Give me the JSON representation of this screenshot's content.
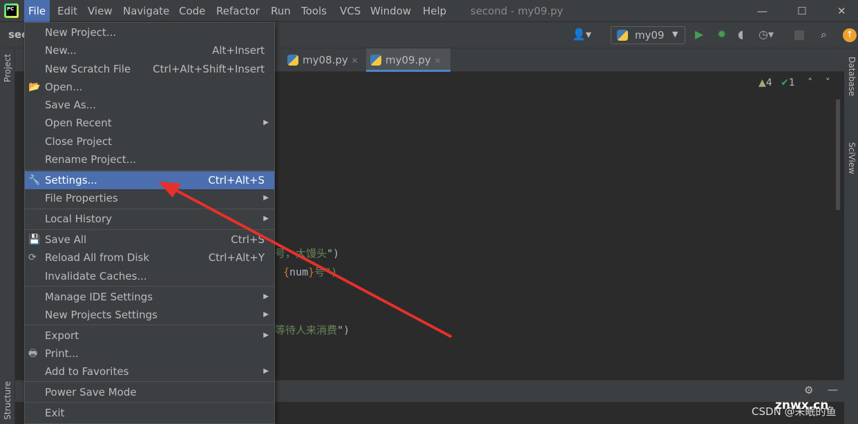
{
  "menubar": {
    "items": [
      "File",
      "Edit",
      "View",
      "Navigate",
      "Code",
      "Refactor",
      "Run",
      "Tools",
      "VCS",
      "Window",
      "Help"
    ],
    "window_title": "second - my09.py"
  },
  "toolbar": {
    "project_crumb": "sec",
    "run_config": "my09"
  },
  "tabs": [
    {
      "label": "my08.py"
    },
    {
      "label": "my09.py",
      "selected": true
    }
  ],
  "inspections": {
    "warnings": "4",
    "ok": "1"
  },
  "side": {
    "left_top": "Project",
    "left_bottom": "Structure",
    "right1": "Database",
    "right2": "SciView"
  },
  "code_lines": [
    {
      "a": "号，大馒头",
      "b": "\")"
    },
    {
      "pre": "{",
      "var": "num",
      "post": "}",
      "b": "号\")"
    },
    {
      "a": "等待人来消费",
      "b": "\")"
    }
  ],
  "file_menu": [
    {
      "label": "New Project..."
    },
    {
      "label": "New...",
      "shortcut": "Alt+Insert"
    },
    {
      "label": "New Scratch File",
      "shortcut": "Ctrl+Alt+Shift+Insert"
    },
    {
      "label": "Open...",
      "icon": "folder-icon"
    },
    {
      "label": "Save As..."
    },
    {
      "label": "Open Recent",
      "submenu": true
    },
    {
      "label": "Close Project"
    },
    {
      "label": "Rename Project..."
    },
    {
      "label": "Settings...",
      "shortcut": "Ctrl+Alt+S",
      "icon": "wrench-icon",
      "highlighted": true
    },
    {
      "label": "File Properties",
      "submenu": true
    },
    {
      "label": "Local History",
      "submenu": true
    },
    {
      "label": "Save All",
      "shortcut": "Ctrl+S",
      "icon": "save-icon"
    },
    {
      "label": "Reload All from Disk",
      "shortcut": "Ctrl+Alt+Y",
      "icon": "reload-icon"
    },
    {
      "label": "Invalidate Caches..."
    },
    {
      "label": "Manage IDE Settings",
      "submenu": true
    },
    {
      "label": "New Projects Settings",
      "submenu": true
    },
    {
      "label": "Export",
      "submenu": true
    },
    {
      "label": "Print...",
      "icon": "printer-icon"
    },
    {
      "label": "Add to Favorites",
      "submenu": true
    },
    {
      "label": "Power Save Mode"
    },
    {
      "label": "Exit"
    }
  ],
  "watermark": "CSDN @未眠的鱼",
  "watermark2": "znwx.cn",
  "colors": {
    "highlight": "#4b6eaf",
    "arrow": "#e8302a",
    "run": "#499c54"
  }
}
